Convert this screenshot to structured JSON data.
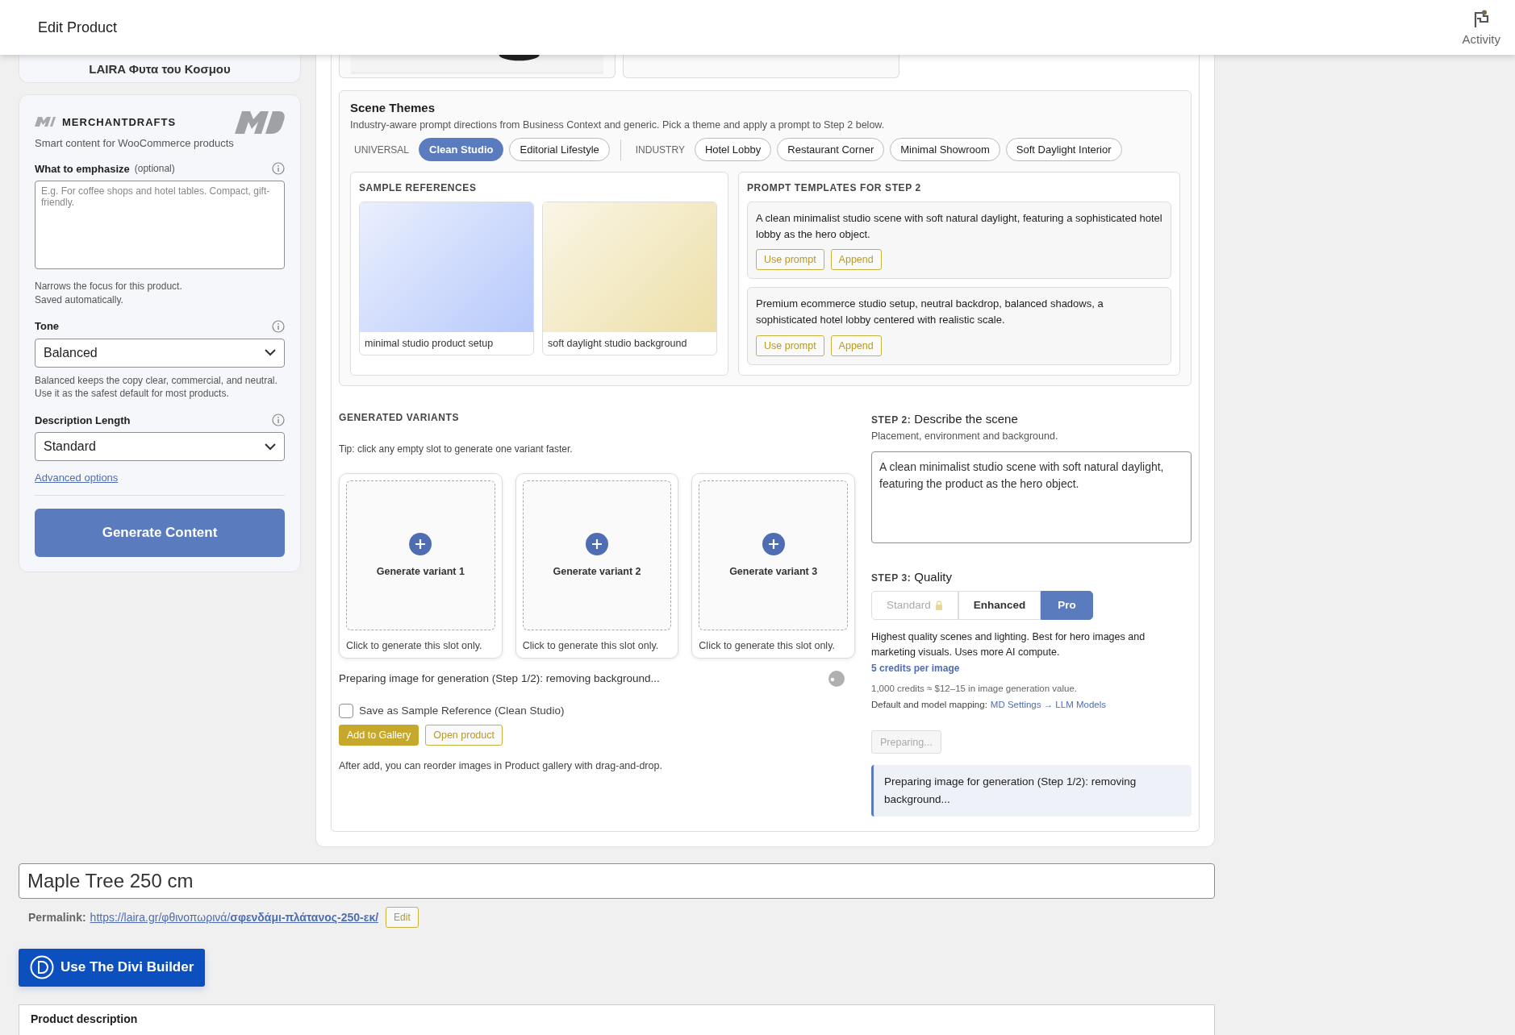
{
  "header": {
    "title": "Edit Product",
    "activity_label": "Activity"
  },
  "store_card": {
    "name": "LAIRA Φυτα του Κοσμου"
  },
  "plugin": {
    "brand": "MERCHANTDRAFTS",
    "tagline": "Smart content for WooCommerce products",
    "emphasize": {
      "label": "What to emphasize",
      "optional": "(optional)",
      "placeholder": "E.g. For coffee shops and hotel tables. Compact, gift-friendly.",
      "help": [
        "Narrows the focus for this product.",
        "Saved automatically."
      ]
    },
    "tone": {
      "label": "Tone",
      "value": "Balanced",
      "help": "Balanced keeps the copy clear, commercial, and neutral. Use it as the safest default for most products."
    },
    "length": {
      "label": "Description Length",
      "value": "Standard"
    },
    "advanced_link": "Advanced options",
    "generate_button": "Generate Content"
  },
  "scene_themes": {
    "title": "Scene Themes",
    "description": "Industry-aware prompt directions from Business Context and generic. Pick a theme and apply a prompt to Step 2 below.",
    "groups": [
      {
        "label": "UNIVERSAL",
        "themes": [
          {
            "label": "Clean Studio",
            "selected": true
          },
          {
            "label": "Editorial Lifestyle",
            "selected": false
          }
        ]
      },
      {
        "label": "INDUSTRY",
        "themes": [
          {
            "label": "Hotel Lobby",
            "selected": false
          },
          {
            "label": "Restaurant Corner",
            "selected": false
          },
          {
            "label": "Minimal Showroom",
            "selected": false
          },
          {
            "label": "Soft Daylight Interior",
            "selected": false
          }
        ]
      }
    ],
    "sample_references": {
      "heading": "SAMPLE REFERENCES",
      "items": [
        {
          "caption": "minimal studio product setup",
          "color": "#b7c9fb"
        },
        {
          "caption": "soft daylight studio background",
          "color": "#eddfa8"
        }
      ]
    },
    "prompt_templates": {
      "heading": "PROMPT TEMPLATES FOR STEP 2",
      "items": [
        {
          "text": "A clean minimalist studio scene with soft natural daylight, featuring a sophisticated hotel lobby as the hero object.",
          "use_label": "Use prompt",
          "append_label": "Append"
        },
        {
          "text": "Premium ecommerce studio setup, neutral backdrop, balanced shadows, a sophisticated hotel lobby centered with realistic scale.",
          "use_label": "Use prompt",
          "append_label": "Append"
        }
      ]
    }
  },
  "variants": {
    "heading": "GENERATED VARIANTS",
    "tip": "Tip: click any empty slot to generate one variant faster.",
    "slots": [
      {
        "label": "Generate variant 1",
        "caption": "Click to generate this slot only."
      },
      {
        "label": "Generate variant 2",
        "caption": "Click to generate this slot only."
      },
      {
        "label": "Generate variant 3",
        "caption": "Click to generate this slot only."
      }
    ],
    "status": "Preparing image for generation (Step 1/2): removing background...",
    "save_reference": {
      "label": "Save as Sample Reference (Clean Studio)",
      "checked": false
    },
    "add_button": "Add to Gallery",
    "open_button": "Open product",
    "note": "After add, you can reorder images in Product gallery with drag-and-drop."
  },
  "step2": {
    "step": "STEP 2:",
    "title": "Describe the scene",
    "description": "Placement, environment and background.",
    "value": "A clean minimalist studio scene with soft natural daylight, featuring the product as the hero object."
  },
  "step3": {
    "step": "STEP 3:",
    "title": "Quality",
    "options": [
      {
        "label": "Standard",
        "selected": false,
        "disabled": true
      },
      {
        "label": "Enhanced",
        "selected": false,
        "disabled": false
      },
      {
        "label": "Pro",
        "selected": true,
        "disabled": false
      }
    ],
    "description": "Highest quality scenes and lighting. Best for hero images and marketing visuals. Uses more AI compute.",
    "credits": "5 credits per image",
    "value_note": "1,000 credits ≈ $12–15 in image generation value.",
    "mapping_label": "Default and model mapping:",
    "mapping_link": "MD Settings → LLM Models"
  },
  "preparing_button": {
    "label": "Preparing...",
    "disabled": true
  },
  "notice": "Preparing image for generation (Step 1/2): removing background...",
  "title_field": {
    "value": "Maple Tree 250 cm"
  },
  "permalink": {
    "label": "Permalink:",
    "url": "https://laira.gr/φθινοπωρινά/**σφενδάμι-πλάτανος-250-εκ/**",
    "edit": "Edit"
  },
  "divi_button": "Use The Divi Builder",
  "product_description": {
    "title": "Product description"
  }
}
